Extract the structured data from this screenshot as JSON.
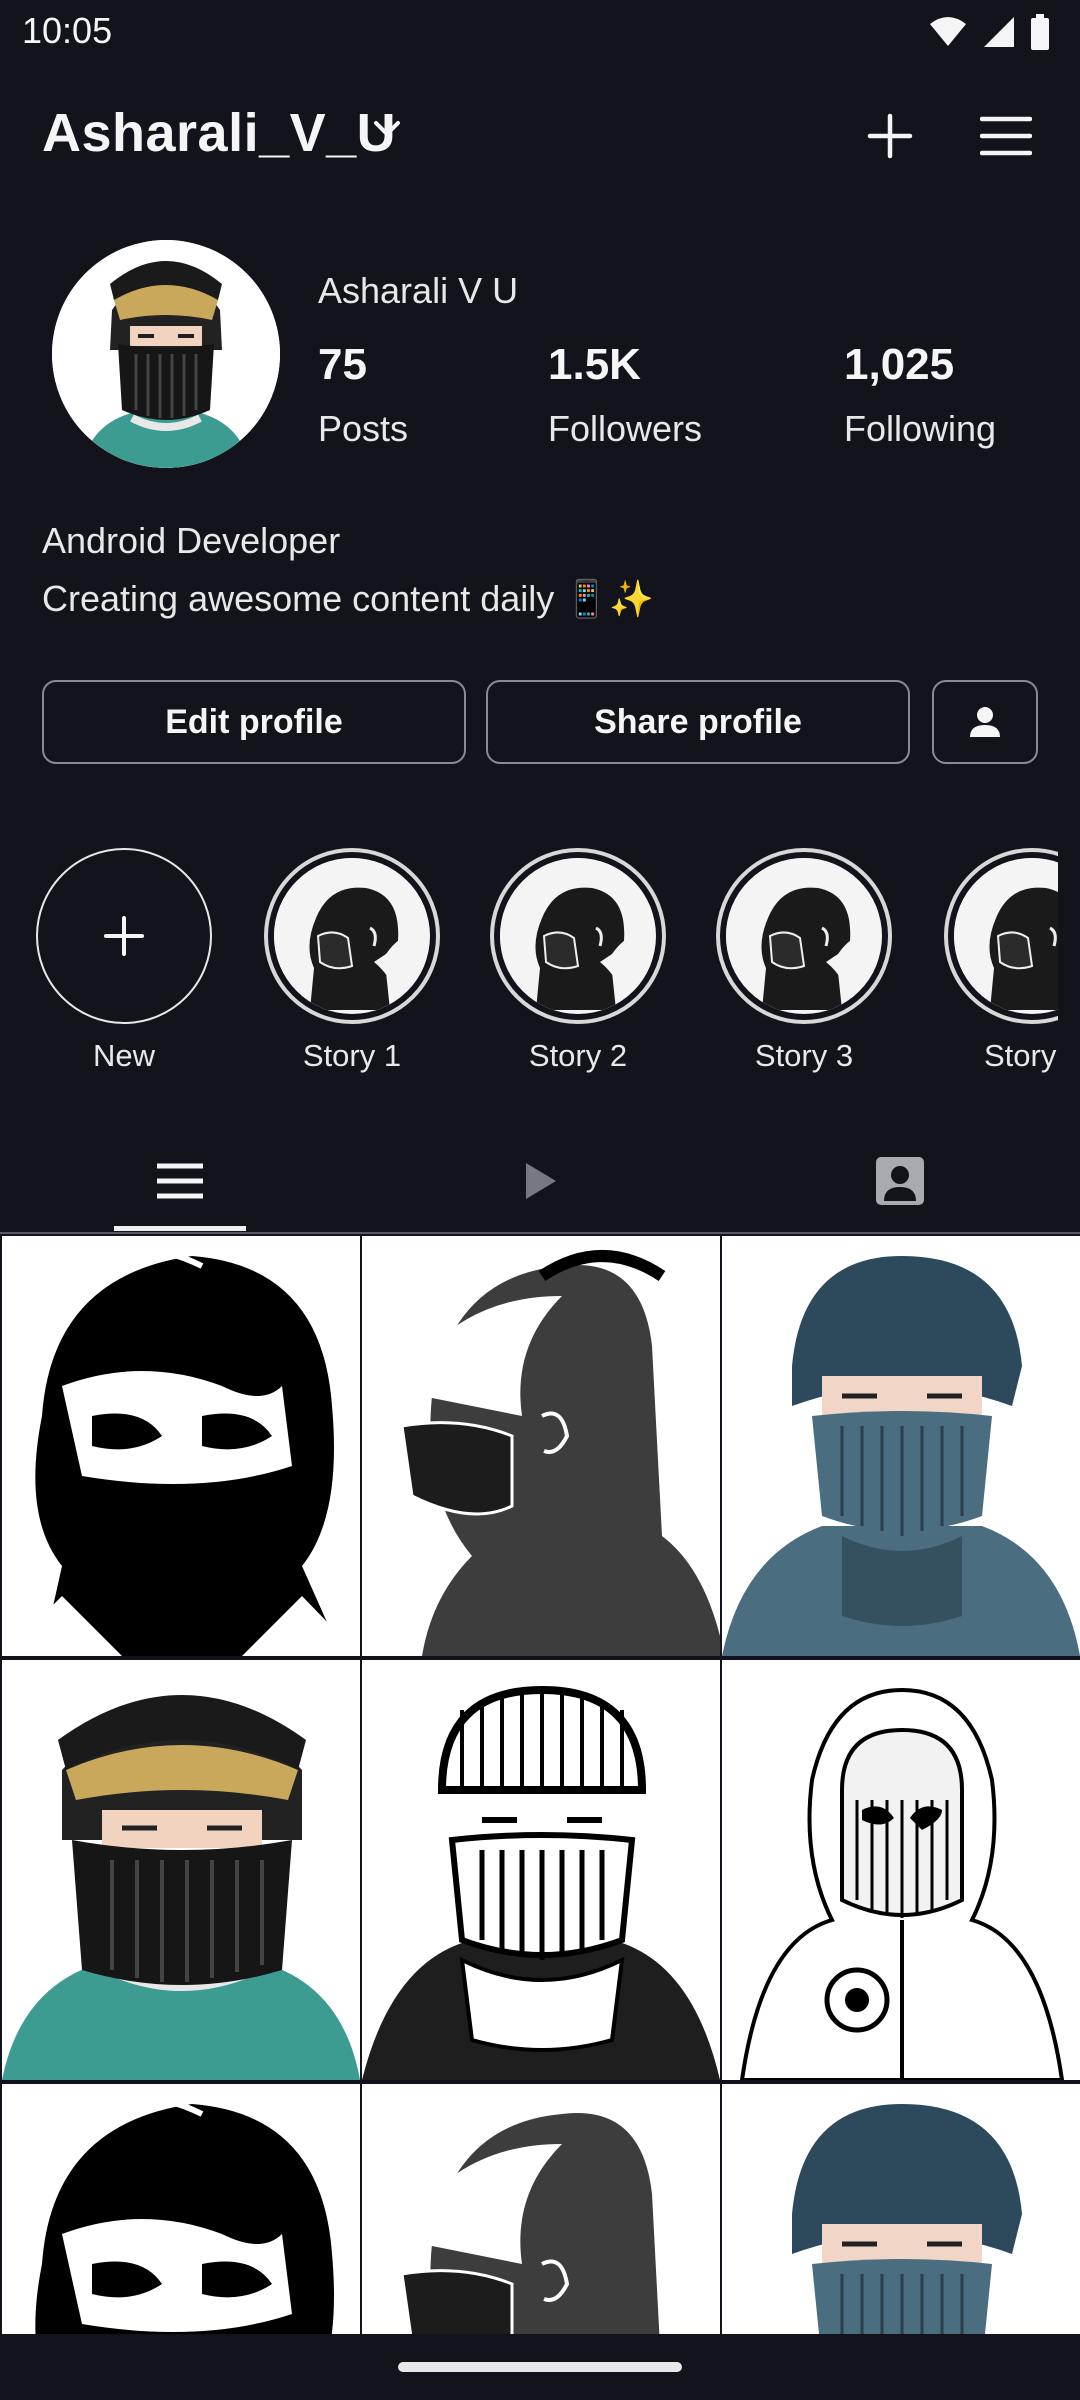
{
  "status_bar": {
    "time": "10:05"
  },
  "profile": {
    "username": "Asharali_V_U",
    "display_name": "Asharali V U",
    "stats": [
      {
        "value": "75",
        "label": "Posts"
      },
      {
        "value": "1.5K",
        "label": "Followers"
      },
      {
        "value": "1,025",
        "label": "Following"
      }
    ],
    "bio_title": "Android Developer",
    "bio_text": "Creating awesome content daily 📱✨"
  },
  "actions": {
    "edit_label": "Edit profile",
    "share_label": "Share profile"
  },
  "stories": [
    {
      "label": "New"
    },
    {
      "label": "Story 1"
    },
    {
      "label": "Story 2"
    },
    {
      "label": "Story 3"
    },
    {
      "label": "Story"
    }
  ],
  "tabs": [
    {
      "icon": "grid-list-icon",
      "selected": true
    },
    {
      "icon": "play-icon",
      "selected": false
    },
    {
      "icon": "tagged-person-icon",
      "selected": false
    }
  ],
  "grid": {
    "posts": [
      {
        "art": "masked-face-bw"
      },
      {
        "art": "mask-profile-grey"
      },
      {
        "art": "balaclava-blue"
      },
      {
        "art": "beanie-teal"
      },
      {
        "art": "beanie-sketch"
      },
      {
        "art": "hoodie-sketch"
      },
      {
        "art": "masked-face-bw"
      },
      {
        "art": "mask-profile-grey"
      },
      {
        "art": "balaclava-blue"
      }
    ]
  },
  "colors": {
    "background": "#12131b",
    "text": "#f5f5f5",
    "border": "#8a8b92",
    "teal": "#3d9c92",
    "steel_blue": "#4b6d80"
  }
}
